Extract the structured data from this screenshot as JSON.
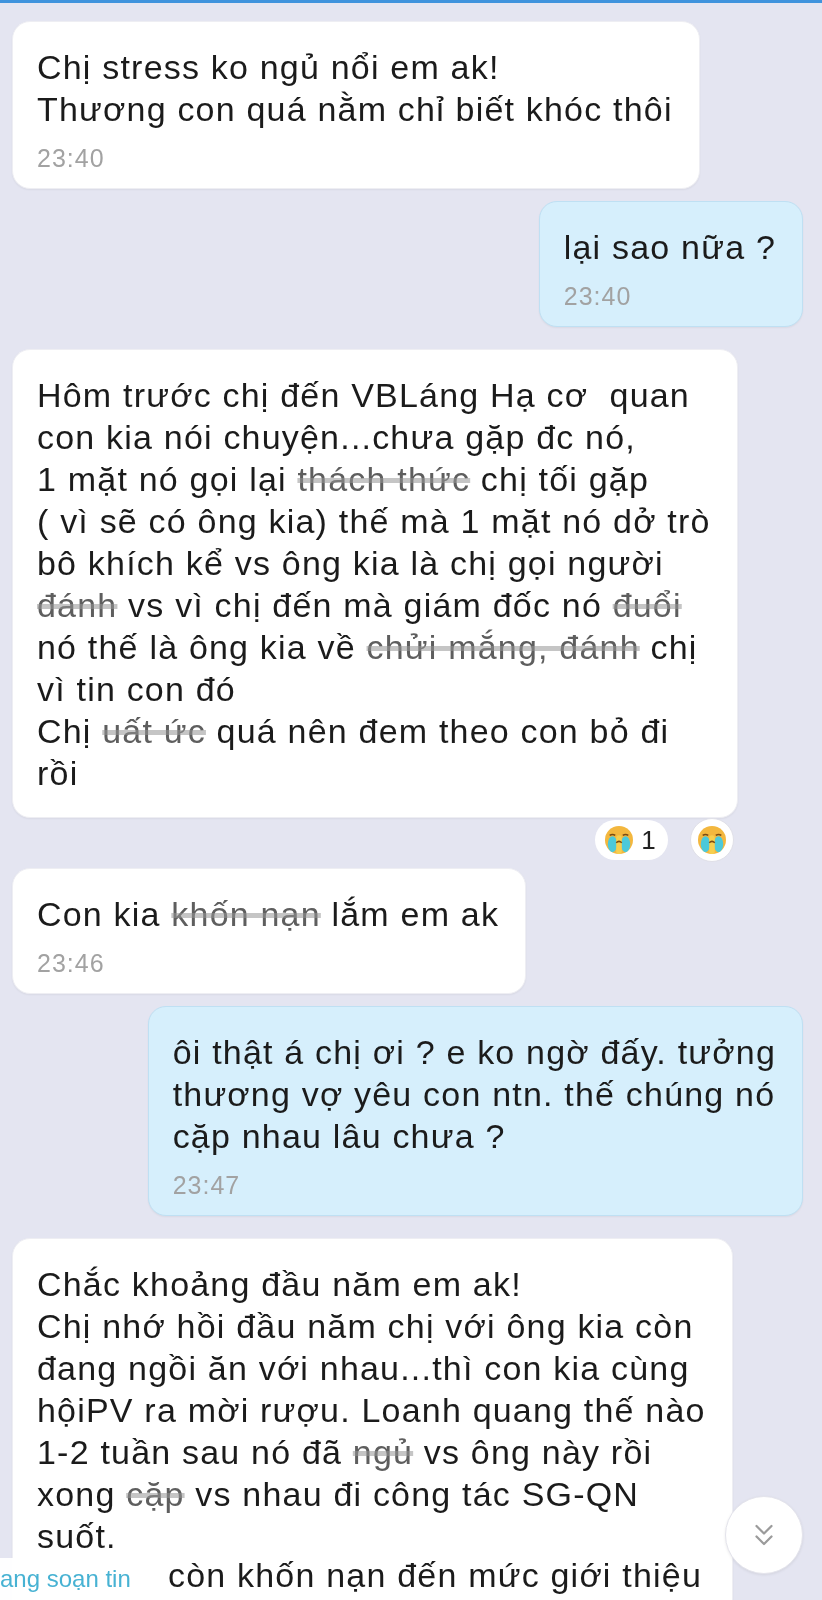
{
  "messages": [
    {
      "kind": "received",
      "lines": [
        [
          {
            "kind": "plain",
            "text": "Chị stress ko ngủ nổi em ak!"
          }
        ],
        [
          {
            "kind": "plain",
            "text": "Thương con quá nằm chỉ biết khóc thôi"
          }
        ]
      ],
      "time": "23:40"
    },
    {
      "kind": "sent",
      "lines": [
        [
          {
            "kind": "plain",
            "text": "lại sao nữa ?"
          }
        ]
      ],
      "time": "23:40"
    },
    {
      "kind": "received",
      "lines": [
        [
          {
            "kind": "plain",
            "text": "Hôm trước chị đến VBLáng Hạ cơ  quan"
          }
        ],
        [
          {
            "kind": "plain",
            "text": "con kia nói chuyện...chưa gặp đc nó,"
          }
        ],
        [
          {
            "kind": "plain",
            "text": "1 mặt nó gọi lại "
          },
          {
            "kind": "smudged",
            "text": "thách thức"
          },
          {
            "kind": "plain",
            "text": " chị tối gặp"
          }
        ],
        [
          {
            "kind": "plain",
            "text": "( vì sẽ có ông kia) thế mà 1 mặt nó dở trò"
          }
        ],
        [
          {
            "kind": "plain",
            "text": "bô khích kể vs ông kia là chị gọi người"
          }
        ],
        [
          {
            "kind": "smudged",
            "text": "đánh"
          },
          {
            "kind": "plain",
            "text": " vs vì chị đến mà giám đốc nó "
          },
          {
            "kind": "smudged",
            "text": "đuổi"
          }
        ],
        [
          {
            "kind": "plain",
            "text": "nó thế là ông kia về "
          },
          {
            "kind": "smudged",
            "text": "chửi mắng, đánh"
          },
          {
            "kind": "plain",
            "text": " chị"
          }
        ],
        [
          {
            "kind": "plain",
            "text": "vì tin con đó"
          }
        ],
        [
          {
            "kind": "plain",
            "text": "Chị "
          },
          {
            "kind": "smudged",
            "text": "uất ức"
          },
          {
            "kind": "plain",
            "text": " quá nên đem theo con bỏ đi"
          }
        ],
        [
          {
            "kind": "plain",
            "text": "rồi"
          }
        ]
      ],
      "reaction": {
        "count": "1"
      }
    },
    {
      "kind": "received",
      "lines": [
        [
          {
            "kind": "plain",
            "text": "Con kia "
          },
          {
            "kind": "smudged",
            "text": "khốn nạn"
          },
          {
            "kind": "plain",
            "text": " lắm em ak"
          }
        ]
      ],
      "time": "23:46"
    },
    {
      "kind": "sent",
      "lines": [
        [
          {
            "kind": "plain",
            "text": "ôi thật á chị ơi ? e ko ngờ đấy. tưởng"
          }
        ],
        [
          {
            "kind": "plain",
            "text": "thương vợ yêu con ntn. thế chúng nó"
          }
        ],
        [
          {
            "kind": "plain",
            "text": "cặp nhau lâu chưa ?"
          }
        ]
      ],
      "time": "23:47"
    },
    {
      "kind": "received",
      "lines": [
        [
          {
            "kind": "plain",
            "text": "Chắc khoảng đầu năm em ak!"
          }
        ],
        [
          {
            "kind": "plain",
            "text": "Chị nhớ hồi đầu năm chị với ông kia còn"
          }
        ],
        [
          {
            "kind": "plain",
            "text": "đang ngồi ăn với nhau...thì con kia cùng"
          }
        ],
        [
          {
            "kind": "plain",
            "text": "hộiPV ra mời rượu. Loanh quang thế nào"
          }
        ],
        [
          {
            "kind": "plain",
            "text": "1-2 tuần sau nó đã "
          },
          {
            "kind": "smudged",
            "text": "ngủ"
          },
          {
            "kind": "plain",
            "text": " vs ông này rồi"
          }
        ],
        [
          {
            "kind": "plain",
            "text": "xong "
          },
          {
            "kind": "smudged",
            "text": "cặp"
          },
          {
            "kind": "plain",
            "text": " vs nhau đi công tác SG-QN"
          }
        ],
        [
          {
            "kind": "plain",
            "text": "suốt."
          }
        ]
      ],
      "cut_line": "còn khốn nạn đến mức giới thiệu"
    }
  ],
  "typing_indicator": "ang soạn tin"
}
